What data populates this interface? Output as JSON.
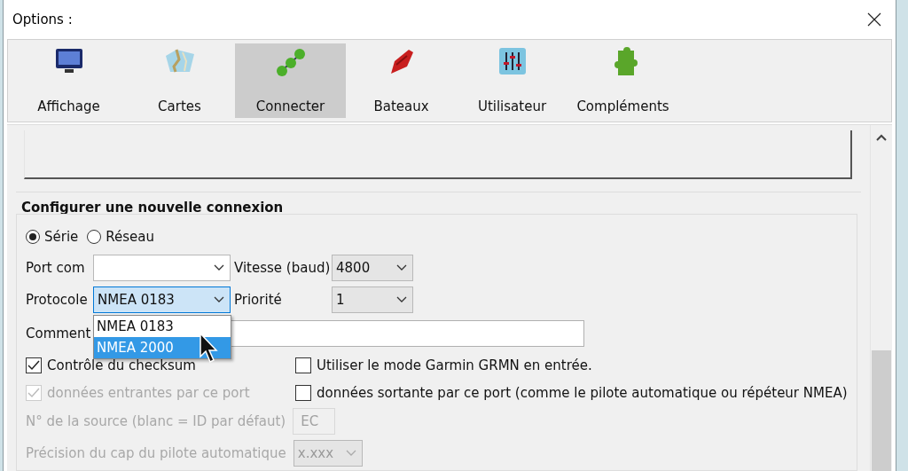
{
  "window": {
    "title": "Options :"
  },
  "tabs": [
    {
      "label": "Affichage",
      "selected": false
    },
    {
      "label": "Cartes",
      "selected": false
    },
    {
      "label": "Connecter",
      "selected": true
    },
    {
      "label": "Bateaux",
      "selected": false
    },
    {
      "label": "Utilisateur",
      "selected": false
    },
    {
      "label": "Compléments",
      "selected": false
    }
  ],
  "new_connection": {
    "title": "Configurer une nouvelle connexion",
    "connection_type": [
      {
        "label": "Série",
        "selected": true
      },
      {
        "label": "Réseau",
        "selected": false
      }
    ],
    "port_com": {
      "label": "Port com"
    },
    "baud_rate": {
      "label": "Vitesse (baud)",
      "value": "4800"
    },
    "protocol": {
      "label": "Protocole",
      "value": "NMEA 0183",
      "focused": true,
      "options": [
        {
          "label": "NMEA 0183",
          "highlighted": false
        },
        {
          "label": "NMEA 2000",
          "highlighted": true
        }
      ]
    },
    "priority": {
      "label": "Priorité",
      "value": "1"
    },
    "comment": {
      "label": "Comment"
    },
    "checkbox_rows": [
      [
        {
          "label": "Contrôle du checksum",
          "checked": true,
          "disabled": false
        },
        {
          "label": "Utiliser le mode Garmin GRMN en entrée.",
          "checked": false,
          "disabled": false
        }
      ],
      [
        {
          "label": "données entrantes par ce port",
          "checked": true,
          "disabled": true
        },
        {
          "label": "données sortante par ce port (comme le pilote automatique ou répéteur NMEA)",
          "checked": false,
          "disabled": false
        }
      ]
    ],
    "source_id": {
      "label": "N° de la source (blanc = ID par défaut)",
      "value": "EC",
      "disabled": true
    },
    "autopilot_precision": {
      "label": "Précision du cap du pilote automatique",
      "value": "x.xxx",
      "disabled": true
    }
  }
}
